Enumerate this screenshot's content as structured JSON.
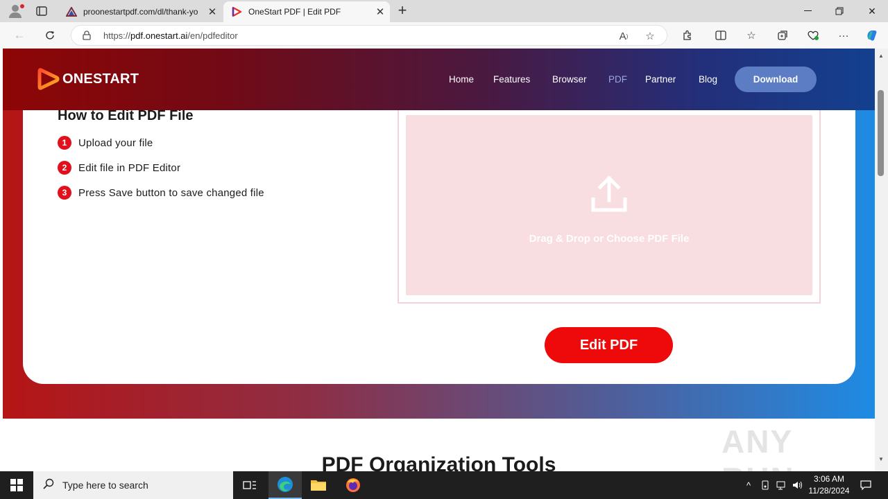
{
  "browser": {
    "tabs": [
      {
        "title": "proonestartpdf.com/dl/thank-yo",
        "favicon": "proonestart-icon"
      },
      {
        "title": "OneStart PDF | Edit PDF",
        "favicon": "onestart-icon",
        "active": true
      }
    ],
    "address": {
      "url_prefix": "https://",
      "url_domain": "pdf.onestart.ai",
      "url_path": "/en/pdfeditor"
    }
  },
  "site": {
    "logo_text": "ONESTART",
    "nav": [
      "Home",
      "Features",
      "Browser",
      "PDF",
      "Partner",
      "Blog"
    ],
    "active_nav": "PDF",
    "download_label": "Download"
  },
  "howto": {
    "title": "How to Edit PDF File",
    "steps": [
      {
        "num": "1",
        "text": "Upload your file"
      },
      {
        "num": "2",
        "text": "Edit file in PDF Editor"
      },
      {
        "num": "3",
        "text": "Press Save button to save changed file"
      }
    ]
  },
  "dropzone": {
    "text": "Drag & Drop or Choose PDF File"
  },
  "edit_button": "Edit PDF",
  "section_title": "PDF Organization Tools",
  "watermark": "ANY RUN",
  "taskbar": {
    "search_placeholder": "Type here to search",
    "time": "3:06 AM",
    "date": "11/28/2024"
  },
  "colors": {
    "accent_red": "#ee0a0a",
    "step_badge": "#e0111c",
    "download_button": "#5c7cc4",
    "active_nav": "#9aa8e2"
  }
}
